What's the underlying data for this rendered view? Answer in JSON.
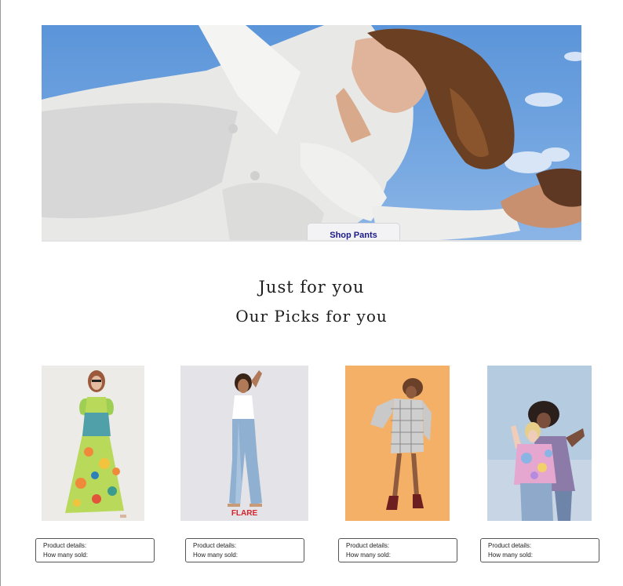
{
  "hero": {
    "button_label": "Shop Pants"
  },
  "section": {
    "title": "Just for you",
    "subtitle": "Our Picks for you"
  },
  "products": [
    {
      "details_label": "Product details:",
      "sold_label": "How many sold:"
    },
    {
      "details_label": "Product details:",
      "sold_label": "How many sold:",
      "brand_mark": "FLARE"
    },
    {
      "details_label": "Product details:",
      "sold_label": "How many sold:"
    },
    {
      "details_label": "Product details:",
      "sold_label": "How many sold:"
    }
  ],
  "colors": {
    "button_text": "#1b1b8a",
    "sky": "#6ea2df",
    "flare_mark": "#d6242a"
  }
}
